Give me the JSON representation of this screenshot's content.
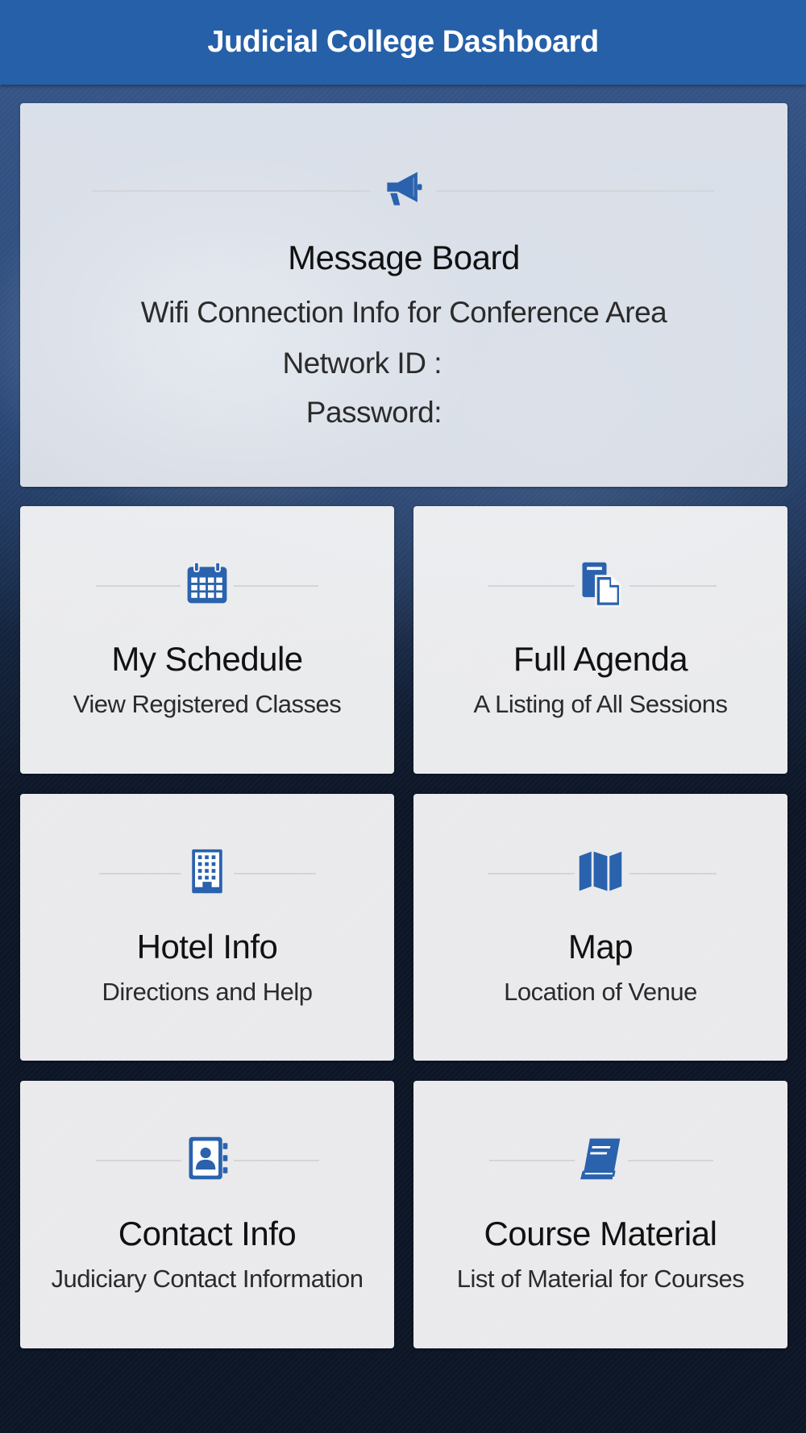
{
  "header": {
    "title": "Judicial College Dashboard"
  },
  "colors": {
    "header": "#2660a8",
    "accent_icon": "#2a62ad",
    "card": "#f4f4f5",
    "background": "#0d1626"
  },
  "message_board": {
    "icon": "megaphone-icon",
    "title": "Message Board",
    "line1": "Wifi Connection Info for Conference Area",
    "network_label": "Network ID :",
    "password_label": "Password:"
  },
  "tiles": [
    {
      "icon": "calendar-icon",
      "title": "My Schedule",
      "subtitle": "View Registered Classes"
    },
    {
      "icon": "documents-icon",
      "title": "Full Agenda",
      "subtitle": "A Listing of All Sessions"
    },
    {
      "icon": "building-icon",
      "title": "Hotel Info",
      "subtitle": "Directions and Help"
    },
    {
      "icon": "map-icon",
      "title": "Map",
      "subtitle": "Location of Venue"
    },
    {
      "icon": "address-book-icon",
      "title": "Contact Info",
      "subtitle": "Judiciary Contact Information"
    },
    {
      "icon": "book-icon",
      "title": "Course Material",
      "subtitle": "List of Material for Courses"
    }
  ]
}
